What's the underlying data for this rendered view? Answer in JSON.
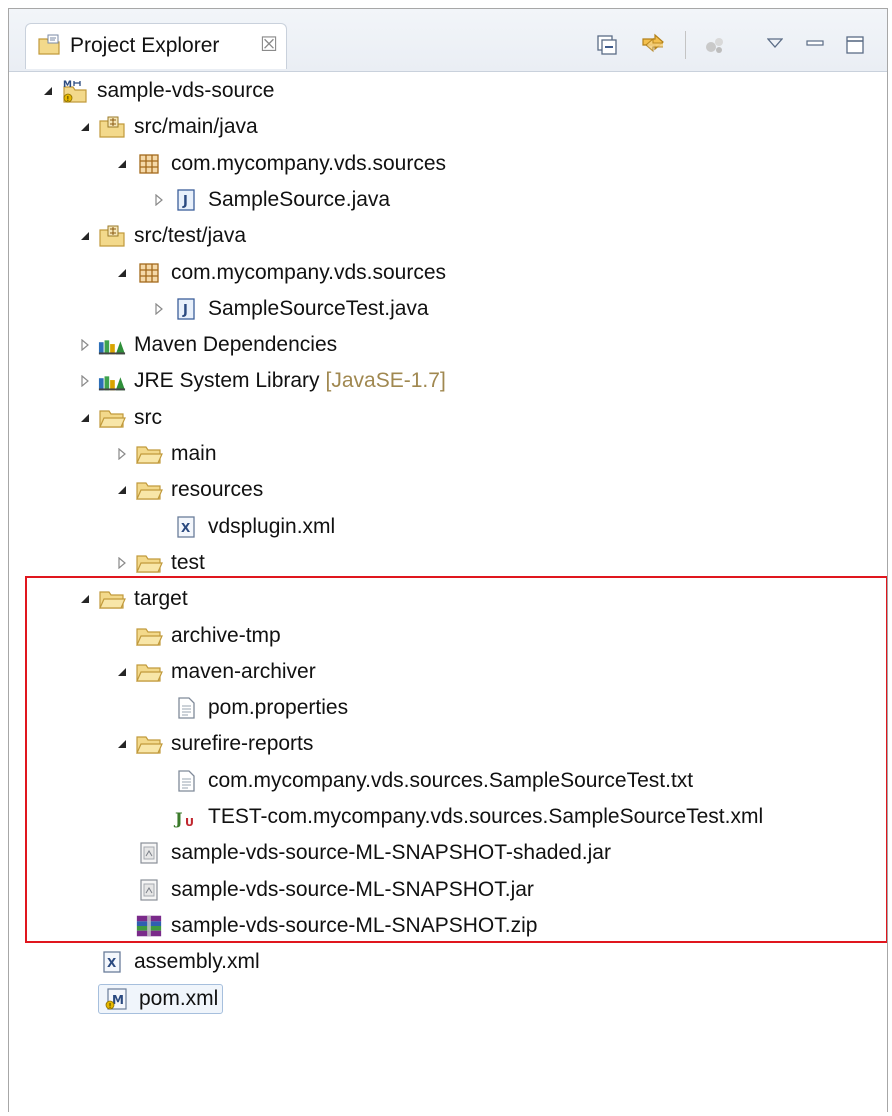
{
  "view": {
    "tab_label": "Project Explorer",
    "tab_close": "☒"
  },
  "toolbar": {
    "collapse_all_icon": "collapse-all-icon",
    "link_with_editor_icon": "link-with-editor-icon",
    "focus_task_icon": "focus-on-active-task-icon",
    "view_menu_icon": "view-menu-icon",
    "minimize_icon": "minimize-icon",
    "maximize_icon": "maximize-icon"
  },
  "tree": [
    {
      "label": "sample-vds-source",
      "twisty": "expanded",
      "icon": "maven-project-icon"
    },
    {
      "label": "src/main/java",
      "twisty": "expanded",
      "icon": "source-folder-icon"
    },
    {
      "label": "com.mycompany.vds.sources",
      "twisty": "expanded",
      "icon": "package-icon"
    },
    {
      "label": "SampleSource.java",
      "twisty": "collapsed",
      "icon": "java-file-icon"
    },
    {
      "label": "src/test/java",
      "twisty": "expanded",
      "icon": "source-folder-icon"
    },
    {
      "label": "com.mycompany.vds.sources",
      "twisty": "expanded",
      "icon": "package-icon"
    },
    {
      "label": "SampleSourceTest.java",
      "twisty": "collapsed",
      "icon": "java-file-icon"
    },
    {
      "label": "Maven Dependencies",
      "twisty": "collapsed",
      "icon": "library-icon"
    },
    {
      "label": "JRE System Library",
      "decoration": "[JavaSE-1.7]",
      "twisty": "collapsed",
      "icon": "library-icon"
    },
    {
      "label": "src",
      "twisty": "expanded",
      "icon": "folder-icon"
    },
    {
      "label": "main",
      "twisty": "collapsed",
      "icon": "folder-icon"
    },
    {
      "label": "resources",
      "twisty": "expanded",
      "icon": "folder-icon"
    },
    {
      "label": "vdsplugin.xml",
      "twisty": "none",
      "icon": "xml-file-icon"
    },
    {
      "label": "test",
      "twisty": "collapsed",
      "icon": "folder-icon"
    },
    {
      "label": "target",
      "twisty": "expanded",
      "icon": "folder-icon"
    },
    {
      "label": "archive-tmp",
      "twisty": "none",
      "icon": "folder-icon"
    },
    {
      "label": "maven-archiver",
      "twisty": "expanded",
      "icon": "folder-icon"
    },
    {
      "label": "pom.properties",
      "twisty": "none",
      "icon": "text-file-icon"
    },
    {
      "label": "surefire-reports",
      "twisty": "expanded",
      "icon": "folder-icon"
    },
    {
      "label": "com.mycompany.vds.sources.SampleSourceTest.txt",
      "twisty": "none",
      "icon": "text-file-icon"
    },
    {
      "label": "TEST-com.mycompany.vds.sources.SampleSourceTest.xml",
      "twisty": "none",
      "icon": "junit-xml-icon"
    },
    {
      "label": "sample-vds-source-ML-SNAPSHOT-shaded.jar",
      "twisty": "none",
      "icon": "jar-file-icon"
    },
    {
      "label": "sample-vds-source-ML-SNAPSHOT.jar",
      "twisty": "none",
      "icon": "jar-file-icon"
    },
    {
      "label": "sample-vds-source-ML-SNAPSHOT.zip",
      "twisty": "none",
      "icon": "zip-archive-icon"
    },
    {
      "label": "assembly.xml",
      "twisty": "none",
      "icon": "xml-file-icon"
    },
    {
      "label": "pom.xml",
      "twisty": "none",
      "icon": "maven-pom-icon",
      "selected": true
    }
  ],
  "colors": {
    "highlight_border": "#e0161e",
    "decoration_text": "#a08850",
    "folder_fill": "#f3d98b",
    "folder_stroke": "#c19a3c"
  }
}
